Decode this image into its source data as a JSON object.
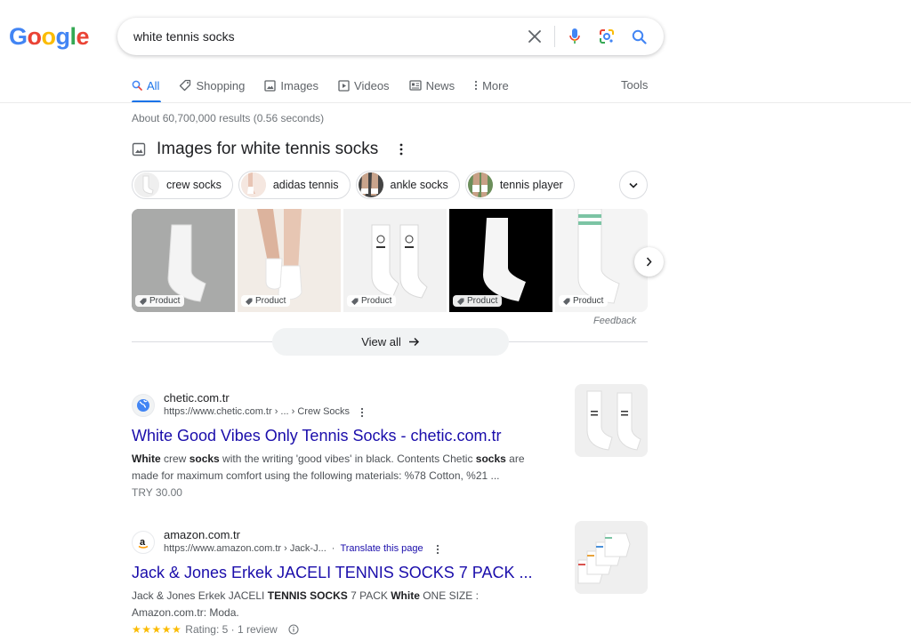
{
  "logo": {
    "letters": [
      "G",
      "o",
      "o",
      "g",
      "l",
      "e"
    ]
  },
  "search": {
    "query": "white tennis socks"
  },
  "tabs": [
    {
      "label": "All",
      "icon": "search-icon"
    },
    {
      "label": "Shopping",
      "icon": "tag-icon"
    },
    {
      "label": "Images",
      "icon": "image-icon"
    },
    {
      "label": "Videos",
      "icon": "play-icon"
    },
    {
      "label": "News",
      "icon": "newspaper-icon"
    },
    {
      "label": "More",
      "icon": "more-vert-icon"
    }
  ],
  "tools_label": "Tools",
  "stats": "About 60,700,000 results (0.56 seconds)",
  "images_block": {
    "title": "Images for white tennis socks",
    "chips": [
      "crew socks",
      "adidas tennis",
      "ankle socks",
      "tennis player"
    ],
    "badge_label": "Product",
    "feedback": "Feedback",
    "view_all": "View all"
  },
  "results": [
    {
      "site": "chetic.com.tr",
      "url": "https://www.chetic.com.tr › ... › Crew Socks",
      "title": "White Good Vibes Only Tennis Socks - chetic.com.tr",
      "snippet_parts": [
        {
          "t": "White",
          "b": true
        },
        {
          "t": " crew ",
          "b": false
        },
        {
          "t": "socks",
          "b": true
        },
        {
          "t": " with the writing 'good vibes' in black. Contents Chetic ",
          "b": false
        },
        {
          "t": "socks",
          "b": true
        },
        {
          "t": " are made for maximum comfort using the following materials: %78 Cotton, %21 ...",
          "b": false
        }
      ],
      "extra": "TRY 30.00"
    },
    {
      "site": "amazon.com.tr",
      "url": "https://www.amazon.com.tr › Jack-J...",
      "translate": "Translate this page",
      "title": "Jack & Jones Erkek JACELI TENNIS SOCKS 7 PACK ...",
      "snippet_parts": [
        {
          "t": "Jack & Jones Erkek JACELI ",
          "b": false
        },
        {
          "t": "TENNIS SOCKS",
          "b": true
        },
        {
          "t": " 7 PACK ",
          "b": false
        },
        {
          "t": "White",
          "b": true
        },
        {
          "t": " ONE SIZE : Amazon.com.tr: Moda.",
          "b": false
        }
      ],
      "stars": "★★★★★",
      "rating": "Rating: 5 · 1 review"
    }
  ],
  "colors": {
    "accent": "#1a73e8",
    "link": "#1a0dab",
    "star": "#fbbc04"
  }
}
